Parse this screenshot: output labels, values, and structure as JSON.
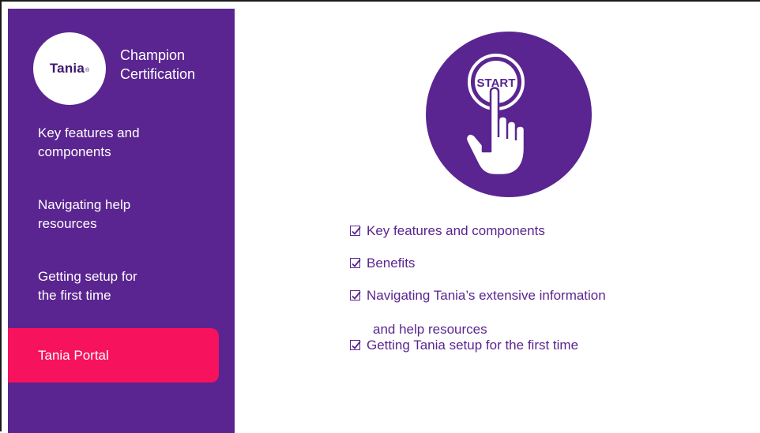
{
  "brand": {
    "logo_text": "Tania",
    "logo_mark": "®",
    "title_line1": "Champion",
    "title_line2": "Certification"
  },
  "sidebar": {
    "items": [
      {
        "line1": "Key features and",
        "line2": "components",
        "active": false
      },
      {
        "line1": "Navigating help",
        "line2": "resources",
        "active": false
      },
      {
        "line1": "Getting setup for",
        "line2": "the first time",
        "active": false
      },
      {
        "line1": "Tania Portal",
        "line2": "",
        "active": true
      }
    ]
  },
  "hero": {
    "button_text": "START",
    "icon": "hand-pressing-start-button-icon"
  },
  "checklist": {
    "items": [
      {
        "line1": "Key features and components",
        "line2": ""
      },
      {
        "line1": "Benefits",
        "line2": ""
      },
      {
        "line1": "Navigating Tania’s extensive information",
        "line2": "and help resources"
      },
      {
        "line1": "Getting Tania setup for the first time",
        "line2": ""
      }
    ]
  },
  "colors": {
    "sidebar_bg": "#5a2590",
    "active_bg": "#f7125e",
    "text_accent": "#5a2590"
  }
}
